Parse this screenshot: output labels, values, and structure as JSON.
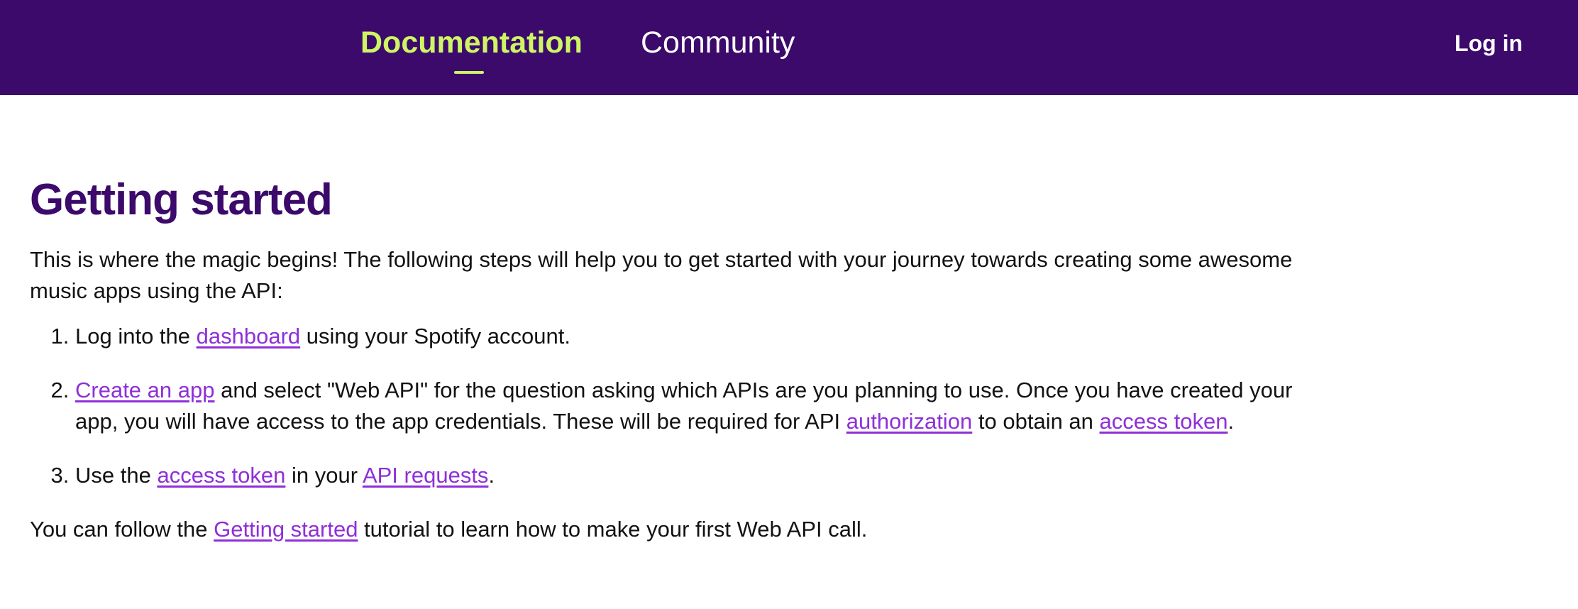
{
  "header": {
    "tabs": [
      {
        "label": "Documentation",
        "active": true
      },
      {
        "label": "Community",
        "active": false
      }
    ],
    "login_label": "Log in",
    "colors": {
      "bar": "#3c0a6b",
      "active_tab": "#cdf564",
      "link": "#8f2fd8"
    }
  },
  "main": {
    "title": "Getting started",
    "intro": "This is where the magic begins! The following steps will help you to get started with your journey towards creating some awesome music apps using the API:",
    "steps": [
      {
        "parts": [
          {
            "text": "Log into the "
          },
          {
            "link": "dashboard"
          },
          {
            "text": " using your Spotify account."
          }
        ]
      },
      {
        "parts": [
          {
            "link": "Create an app"
          },
          {
            "text": " and select \"Web API\" for the question asking which APIs are you planning to use. Once you have created your app, you will have access to the app credentials. These will be required for API "
          },
          {
            "link": "authorization"
          },
          {
            "text": " to obtain an "
          },
          {
            "link": "access token"
          },
          {
            "text": "."
          }
        ]
      },
      {
        "parts": [
          {
            "text": "Use the "
          },
          {
            "link": "access token"
          },
          {
            "text": " in your "
          },
          {
            "link": "API requests"
          },
          {
            "text": "."
          }
        ]
      }
    ],
    "outro": {
      "parts": [
        {
          "text": "You can follow the "
        },
        {
          "link": "Getting started"
        },
        {
          "text": " tutorial to learn how to make your first Web API call."
        }
      ]
    }
  }
}
